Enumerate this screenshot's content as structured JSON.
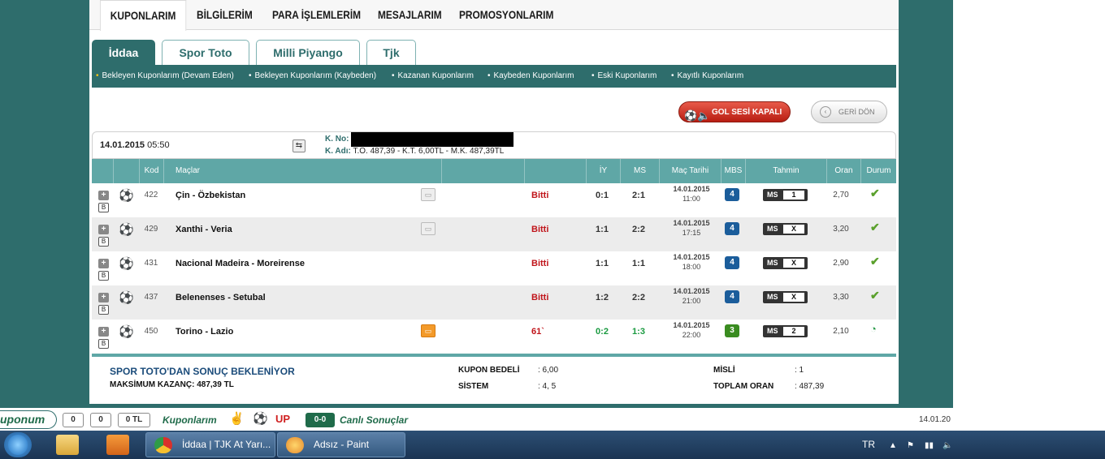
{
  "topnav": [
    "KUPONLARIM",
    "BİLGİLERİM",
    "PARA İŞLEMLERİM",
    "MESAJLARIM",
    "PROMOSYONLARIM"
  ],
  "tabs": [
    "İddaa",
    "Spor Toto",
    "Milli Piyango",
    "Tjk"
  ],
  "subnav": [
    "Bekleyen Kuponlarım (Devam Eden)",
    "Bekleyen Kuponlarım (Kaybeden)",
    "Kazanan Kuponlarım",
    "Kaybeden Kuponlarım",
    "Eski Kuponlarım",
    "Kayıtlı Kuponlarım"
  ],
  "buttons": {
    "gol": "GOL SESİ KAPALI",
    "geri": "GERİ DÖN"
  },
  "coupon": {
    "date": "14.01.2015",
    "time": "05:50",
    "kno_label": "K. No:",
    "kadi_label": "K. Adı:",
    "kadi_value": "T.O. 487,39 - K.T. 6,00TL - M.K. 487,39TL"
  },
  "headers": [
    "Kod",
    "Maçlar",
    "İY",
    "MS",
    "Maç Tarihi",
    "MBS",
    "Tahmin",
    "Oran",
    "Durum"
  ],
  "rows": [
    {
      "kod": "422",
      "mac": "Çin - Özbekistan",
      "status": "Bitti",
      "iy": "0:1",
      "ms": "2:1",
      "date": "14.01.2015",
      "time": "11:00",
      "mbs": "4",
      "tahmin_label": "MS",
      "tahmin": "1",
      "oran": "2,70",
      "durum": "✔"
    },
    {
      "kod": "429",
      "mac": "Xanthi - Veria",
      "status": "Bitti",
      "iy": "1:1",
      "ms": "2:2",
      "date": "14.01.2015",
      "time": "17:15",
      "mbs": "4",
      "tahmin_label": "MS",
      "tahmin": "X",
      "oran": "3,20",
      "durum": "✔"
    },
    {
      "kod": "431",
      "mac": "Nacional Madeira - Moreirense",
      "status": "Bitti",
      "iy": "1:1",
      "ms": "1:1",
      "date": "14.01.2015",
      "time": "18:00",
      "mbs": "4",
      "tahmin_label": "MS",
      "tahmin": "X",
      "oran": "2,90",
      "durum": "✔"
    },
    {
      "kod": "437",
      "mac": "Belenenses - Setubal",
      "status": "Bitti",
      "iy": "1:2",
      "ms": "2:2",
      "date": "14.01.2015",
      "time": "21:00",
      "mbs": "4",
      "tahmin_label": "MS",
      "tahmin": "X",
      "oran": "3,30",
      "durum": "✔"
    },
    {
      "kod": "450",
      "mac": "Torino - Lazio",
      "status": "61`",
      "iy": "0:2",
      "ms": "1:3",
      "date": "14.01.2015",
      "time": "22:00",
      "mbs": "3",
      "tahmin_label": "MS",
      "tahmin": "2",
      "oran": "2,10",
      "durum": "◔"
    }
  ],
  "footer": {
    "spor": "SPOR TOTO'DAN SONUÇ BEKLENİYOR",
    "maks_label": "MAKSİMUM KAZANÇ:",
    "maks_value": "487,39 TL",
    "bedel_label": "KUPON BEDELİ",
    "bedel_value": ": 6,00",
    "sistem_label": "SİSTEM",
    "sistem_value": ": 4, 5",
    "misli_label": "MİSLİ",
    "misli_value": ": 1",
    "toplam_label": "TOPLAM ORAN",
    "toplam_value": ": 487,39"
  },
  "toolbar": {
    "logo": "uponum",
    "count1": "0",
    "count2": "0",
    "count3": "0 TL",
    "kuponlarim": "Kuponlarım",
    "canli": "Canlı Sonuçlar",
    "score_icon": "0-0",
    "date": "14.01.20"
  },
  "taskbar": {
    "chrome_title": "İddaa | TJK At Yarı...",
    "paint_title": "Adsız - Paint",
    "lang": "TR"
  },
  "colors": {
    "teal": "#2e6d6c",
    "header_teal": "#5fa7a6",
    "red": "#c0141a",
    "green": "#1a9a40"
  }
}
